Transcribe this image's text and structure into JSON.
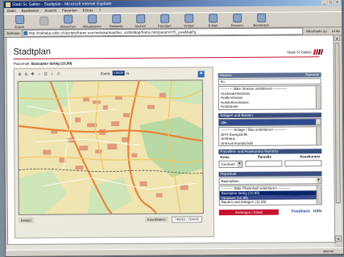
{
  "window": {
    "title": "Stadt St. Gallen - Stadtplan - Microsoft Internet Explorer",
    "controls": [
      "_",
      "□",
      "×"
    ]
  },
  "menu": [
    "Datei",
    "Bearbeiten",
    "Ansicht",
    "Favoriten",
    "Extras",
    "?"
  ],
  "toolbar": [
    {
      "label": "Zurück",
      "enabled": true
    },
    {
      "label": "",
      "enabled": false
    },
    {
      "label": "Abbrechen",
      "enabled": true
    },
    {
      "label": "Aktualisieren",
      "enabled": true
    },
    {
      "label": "Startseite",
      "enabled": true
    },
    {
      "label": "Suchen",
      "enabled": true
    },
    {
      "label": "Favoriten",
      "enabled": true
    },
    {
      "label": "Verlauf",
      "enabled": true
    },
    {
      "label": "E-Mail",
      "enabled": true
    },
    {
      "label": "Drucken",
      "enabled": true
    },
    {
      "label": "Bearbeiten",
      "enabled": true
    }
  ],
  "address": {
    "label": "Adresse",
    "url": "http://mahaka.isdsc.ch/scripts/frame.exe/mahaka/mapfiles_v3/ibsMap/frame.htm/param=HS_javaMapFg",
    "go": "Wechseln zu",
    "links": "Links"
  },
  "page": {
    "title": "Stadtplan",
    "city_name": "Stadt St.Gallen",
    "plan_label": "Planinhalt:",
    "plan_value": "Basisplan farbig (10,99)"
  },
  "map": {
    "tools": [
      "⊕",
      "⊖",
      "✥",
      "⌕",
      "⊡",
      "ⅰ",
      "⎙"
    ],
    "zoom_label": "Zoom:",
    "zoom_value": "1:8500",
    "zoom_unit": "m",
    "scale_label": "Distanz",
    "coords_label": "Koordinaten:",
    "coords_value": "746052 / 254000"
  },
  "sidebar": {
    "strasse": {
      "header": "Strasse",
      "header_right": "Nummer",
      "input": "ho",
      "items": [
        "---------- Bitte Strasse selektieren -----------",
        "Hochwachtstrasse",
        "Hodlerstrasse",
        "Hofstettenstrasse",
        "Hofstrasse"
      ]
    },
    "anlagen": {
      "header": "Anlagen und Bauten",
      "dropdown": "Alle",
      "items": [
        "---------- Anlage / Bau selektieren ----------",
        "AHV-Zweigstelle",
        "Amthaus",
        "Amtsvormundschaft"
      ]
    },
    "parzellen": {
      "header": "Parzellen- und Assekuranz-Nummer",
      "col1": "Kreis",
      "col2": "Parzelle",
      "col3": "Assekuranz",
      "kreis_value": "Centrum"
    },
    "planinhalt": {
      "header": "Planinhalt",
      "dropdown": "Basispläne",
      "items": [
        "---------- Bitte Planinhalt selektieren ----------",
        "Basisplan farbig (10,99)",
        "Strassen (10,99)",
        "Bauten und Anlagen (11.99)"
      ],
      "selected_index": 1
    },
    "bottom": {
      "button": "Anfangen / Inhalt",
      "feedback": "Feedback",
      "hilfe": "Hilfe"
    }
  },
  "status": {
    "text": "",
    "zone": "Internet"
  }
}
